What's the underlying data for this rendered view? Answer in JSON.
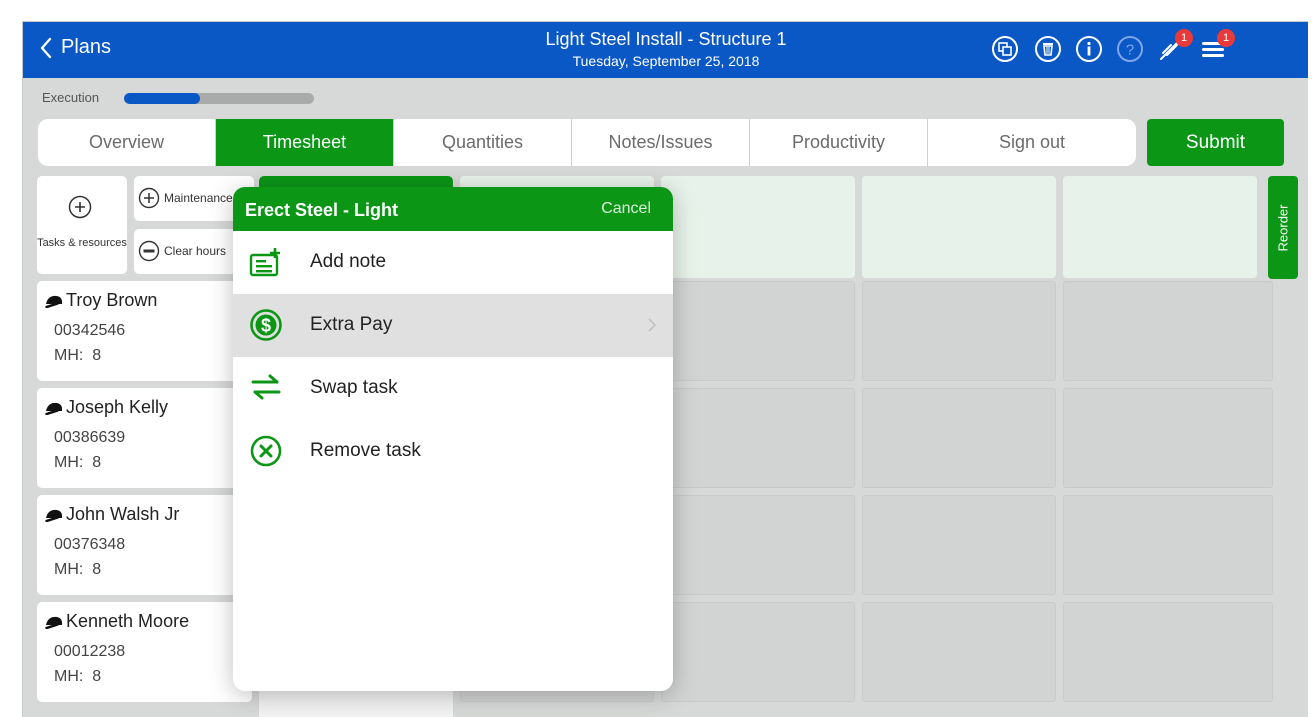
{
  "header": {
    "back_label": "Plans",
    "title": "Light Steel Install - Structure 1",
    "date": "Tuesday, September 25, 2018",
    "notification_badge": "1",
    "menu_badge": "1",
    "icons": [
      "copy-icon",
      "trash-icon",
      "info-icon",
      "help-icon",
      "notification-icon",
      "menu-icon"
    ]
  },
  "execution": {
    "label": "Execution",
    "progress": 0.4
  },
  "tabs": [
    {
      "label": "Overview",
      "active": false
    },
    {
      "label": "Timesheet",
      "active": true
    },
    {
      "label": "Quantities",
      "active": false
    },
    {
      "label": "Notes/Issues",
      "active": false
    },
    {
      "label": "Productivity",
      "active": false
    },
    {
      "label": "Sign out",
      "active": false
    }
  ],
  "submit_label": "Submit",
  "tools": {
    "tasks_resources": "Tasks & resources",
    "maintenance": "Maintenance",
    "clear_hours": "Clear hours"
  },
  "workers": [
    {
      "name": "Troy Brown",
      "id": "00342546",
      "mh_label": "MH:",
      "mh": "8"
    },
    {
      "name": "Joseph Kelly",
      "id": "00386639",
      "mh_label": "MH:",
      "mh": "8"
    },
    {
      "name": "John Walsh Jr",
      "id": "00376348",
      "mh_label": "MH:",
      "mh": "8"
    },
    {
      "name": "Kenneth Moore",
      "id": "00012238",
      "mh_label": "MH:",
      "mh": "8"
    }
  ],
  "reorder_label": "Reorder",
  "popover": {
    "title": "Erect Steel - Light",
    "cancel": "Cancel",
    "items": [
      {
        "label": "Add note",
        "icon": "add-note-icon"
      },
      {
        "label": "Extra Pay",
        "icon": "dollar-icon",
        "highlighted": true,
        "has_submenu": true
      },
      {
        "label": "Swap task",
        "icon": "swap-icon"
      },
      {
        "label": "Remove task",
        "icon": "remove-icon"
      }
    ]
  },
  "colors": {
    "header_blue": "#0a57c6",
    "accent_green": "#0b9616",
    "background": "#d7d9d8",
    "badge_red": "#e83a3a"
  }
}
